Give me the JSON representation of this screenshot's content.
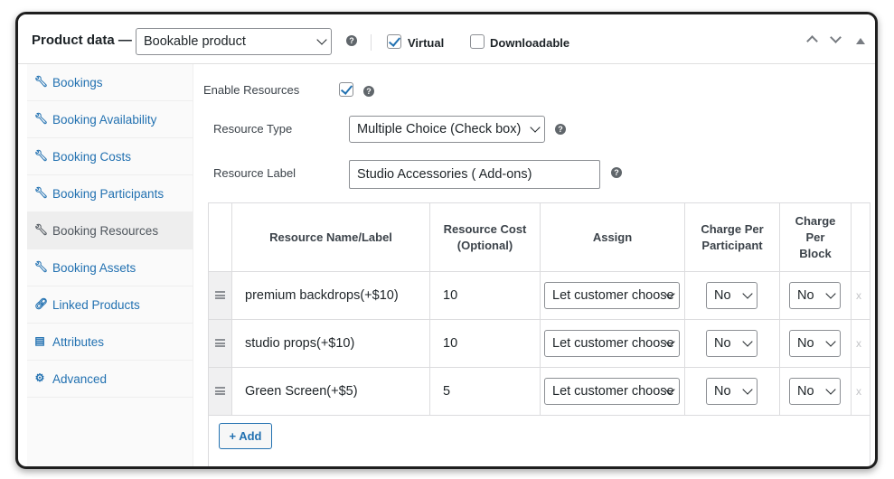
{
  "header": {
    "title": "Product data —",
    "product_type": "Bookable product",
    "virtual_label": "Virtual",
    "virtual_checked": true,
    "downloadable_label": "Downloadable",
    "downloadable_checked": false,
    "help": "?"
  },
  "sidebar": {
    "items": [
      {
        "label": "Bookings",
        "icon": "wrench-icon",
        "active": false
      },
      {
        "label": "Booking Availability",
        "icon": "wrench-icon",
        "active": false
      },
      {
        "label": "Booking Costs",
        "icon": "wrench-icon",
        "active": false
      },
      {
        "label": "Booking Participants",
        "icon": "wrench-icon",
        "active": false
      },
      {
        "label": "Booking Resources",
        "icon": "wrench-icon",
        "active": true
      },
      {
        "label": "Booking Assets",
        "icon": "wrench-icon",
        "active": false
      },
      {
        "label": "Linked Products",
        "icon": "link-icon",
        "active": false
      },
      {
        "label": "Attributes",
        "icon": "table-icon",
        "active": false
      },
      {
        "label": "Advanced",
        "icon": "gear-icon",
        "active": false
      }
    ]
  },
  "form": {
    "enable_resources_label": "Enable Resources",
    "enable_resources_checked": true,
    "resource_type_label": "Resource Type",
    "resource_type_value": "Multiple Choice (Check box)",
    "resource_label_label": "Resource Label",
    "resource_label_value": "Studio Accessories ( Add-ons)"
  },
  "table": {
    "headers": {
      "name": "Resource Name/Label",
      "cost": "Resource Cost (Optional)",
      "assign": "Assign",
      "per_participant": "Charge Per Participant",
      "per_block": "Charge Per Block"
    },
    "rows": [
      {
        "name": "premium backdrops(+$10)",
        "cost": "10",
        "assign": "Let customer choose",
        "per_participant": "No",
        "per_block": "No",
        "remove": "x"
      },
      {
        "name": "studio props(+$10)",
        "cost": "10",
        "assign": "Let customer choose",
        "per_participant": "No",
        "per_block": "No",
        "remove": "x"
      },
      {
        "name": "Green Screen(+$5)",
        "cost": "5",
        "assign": "Let customer choose",
        "per_participant": "No",
        "per_block": "No",
        "remove": "x"
      }
    ],
    "add_label": "+ Add"
  },
  "colors": {
    "accent": "#2271b1",
    "text": "#1d2327",
    "border": "#dcdcde"
  }
}
